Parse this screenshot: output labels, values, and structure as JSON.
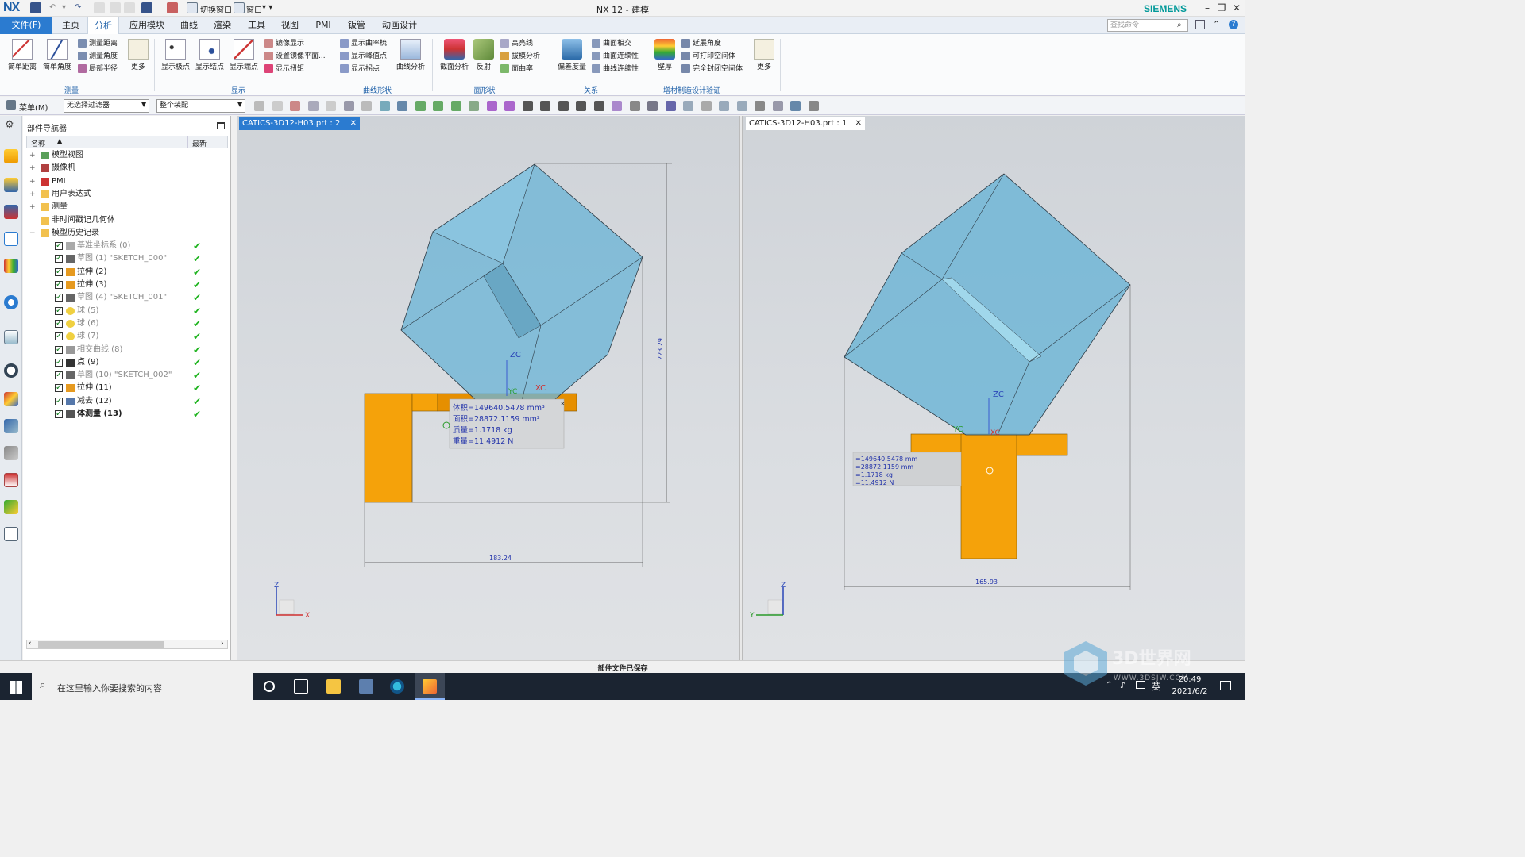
{
  "title_bar": {
    "logo": "NX",
    "window_title": "NX 12 - 建模",
    "brand": "SIEMENS",
    "switch_window_label": "切换窗口",
    "window_menu_label": "窗口"
  },
  "menu": {
    "file": "文件(F)",
    "items": [
      "主页",
      "分析",
      "应用模块",
      "曲线",
      "渲染",
      "工具",
      "视图",
      "PMI",
      "钣管",
      "动画设计"
    ],
    "active": "分析",
    "search_placeholder": "查找命令"
  },
  "ribbon": {
    "measure": {
      "label": "测量",
      "big": [
        "简单距离",
        "简单角度"
      ],
      "small": [
        "测量距离",
        "测量角度",
        "局部半径"
      ],
      "more": "更多"
    },
    "display": {
      "label": "显示",
      "big": [
        "显示极点",
        "显示结点",
        "显示端点"
      ],
      "small": [
        "镜像显示",
        "设置镜像平面...",
        "显示扭矩"
      ]
    },
    "curve_shape": {
      "label": "曲线形状",
      "small": [
        "显示曲率梳",
        "显示峰值点",
        "显示拐点"
      ],
      "big": [
        "曲线分析"
      ]
    },
    "face_shape": {
      "label": "面形状",
      "big": [
        "截面分析",
        "反射"
      ],
      "small": [
        "高亮线",
        "拔模分析",
        "面曲率"
      ]
    },
    "relation": {
      "label": "关系",
      "big": [
        "偏差度量"
      ],
      "small": [
        "曲面相交",
        "曲面连续性",
        "曲线连续性"
      ]
    },
    "am": {
      "label": "增材制造设计验证",
      "big": [
        "壁厚"
      ],
      "small": [
        "延展角度",
        "可打印空间体",
        "完全封闭空间体"
      ],
      "more": "更多"
    }
  },
  "toolbar": {
    "menu_label": "菜单(M)",
    "filter": "无选择过滤器",
    "scope": "整个装配"
  },
  "navigator": {
    "title": "部件导航器",
    "col_name": "名称",
    "col_latest": "最新",
    "rows": [
      {
        "indent": 0,
        "expand": "+",
        "label": "模型视图",
        "grey": false,
        "checked": false,
        "latest": false,
        "icon": "views-icon"
      },
      {
        "indent": 0,
        "expand": "+",
        "label": "摄像机",
        "grey": false,
        "checked": false,
        "latest": false,
        "icon": "camera-icon"
      },
      {
        "indent": 0,
        "expand": "+",
        "label": "PMI",
        "grey": false,
        "checked": false,
        "latest": false,
        "icon": "pmi-icon"
      },
      {
        "indent": 0,
        "expand": "+",
        "label": "用户表达式",
        "grey": false,
        "checked": false,
        "latest": false,
        "icon": "folder-icon"
      },
      {
        "indent": 0,
        "expand": "+",
        "label": "测量",
        "grey": false,
        "checked": false,
        "latest": false,
        "icon": "folder-icon"
      },
      {
        "indent": 0,
        "expand": "",
        "label": "非时间戳记几何体",
        "grey": false,
        "checked": false,
        "latest": false,
        "icon": "folder-icon"
      },
      {
        "indent": 0,
        "expand": "−",
        "label": "模型历史记录",
        "grey": false,
        "checked": false,
        "latest": false,
        "icon": "folder-icon"
      },
      {
        "indent": 1,
        "expand": "",
        "label": "基准坐标系 (0)",
        "grey": true,
        "checked": true,
        "latest": true,
        "icon": "csys-icon"
      },
      {
        "indent": 1,
        "expand": "",
        "label": "草图 (1) \"SKETCH_000\"",
        "grey": true,
        "checked": true,
        "latest": true,
        "icon": "sketch-icon"
      },
      {
        "indent": 1,
        "expand": "",
        "label": "拉伸 (2)",
        "grey": false,
        "checked": true,
        "latest": true,
        "icon": "extrude-icon"
      },
      {
        "indent": 1,
        "expand": "",
        "label": "拉伸 (3)",
        "grey": false,
        "checked": true,
        "latest": true,
        "icon": "extrude-icon"
      },
      {
        "indent": 1,
        "expand": "",
        "label": "草图 (4) \"SKETCH_001\"",
        "grey": true,
        "checked": true,
        "latest": true,
        "icon": "sketch-icon"
      },
      {
        "indent": 1,
        "expand": "",
        "label": "球 (5)",
        "grey": true,
        "checked": true,
        "latest": true,
        "icon": "sphere-icon"
      },
      {
        "indent": 1,
        "expand": "",
        "label": "球 (6)",
        "grey": true,
        "checked": true,
        "latest": true,
        "icon": "sphere-icon"
      },
      {
        "indent": 1,
        "expand": "",
        "label": "球 (7)",
        "grey": true,
        "checked": true,
        "latest": true,
        "icon": "sphere-icon"
      },
      {
        "indent": 1,
        "expand": "",
        "label": "相交曲线 (8)",
        "grey": true,
        "checked": true,
        "latest": true,
        "icon": "curve-icon"
      },
      {
        "indent": 1,
        "expand": "",
        "label": "点 (9)",
        "grey": false,
        "checked": true,
        "latest": true,
        "icon": "point-icon"
      },
      {
        "indent": 1,
        "expand": "",
        "label": "草图 (10) \"SKETCH_002\"",
        "grey": true,
        "checked": true,
        "latest": true,
        "icon": "sketch-icon"
      },
      {
        "indent": 1,
        "expand": "",
        "label": "拉伸 (11)",
        "grey": false,
        "checked": true,
        "latest": true,
        "icon": "extrude-icon"
      },
      {
        "indent": 1,
        "expand": "",
        "label": "减去 (12)",
        "grey": false,
        "checked": true,
        "latest": true,
        "icon": "subtract-icon"
      },
      {
        "indent": 1,
        "expand": "",
        "label": "体测量 (13)",
        "grey": false,
        "checked": true,
        "latest": true,
        "icon": "measure-icon",
        "bold": true
      }
    ]
  },
  "viewport_left": {
    "tab": "CATICS-3D12-H03.prt : 2",
    "dim_height": "223.29",
    "dim_width": "183.24",
    "axes": {
      "z": "ZC",
      "y": "YC",
      "x": "XC"
    },
    "triad": {
      "z": "Z",
      "x": "X"
    },
    "results": [
      "体积=149640.5478 mm³",
      "面积=28872.1159 mm²",
      "质量=1.1718 kg",
      "重量=11.4912 N"
    ]
  },
  "viewport_right": {
    "tab": "CATICS-3D12-H03.prt : 1",
    "dim_width": "165.93",
    "axes": {
      "z": "ZC",
      "y": "YC",
      "x": "XC"
    },
    "triad": {
      "z": "Z",
      "y": "Y"
    },
    "results": [
      "=149640.5478 mm",
      "=28872.1159 mm",
      "=1.1718 kg",
      "=11.4912 N"
    ]
  },
  "status": {
    "message": "部件文件已保存"
  },
  "taskbar": {
    "search_placeholder": "在这里输入你要搜索的内容",
    "time": "20:49",
    "date": "2021/6/2",
    "ime": "英"
  },
  "watermark": {
    "text": "3D世界网",
    "url": "WWW.3DSJW.COM"
  },
  "colors": {
    "accent": "#2b7bd0",
    "cube": "#6db5d6",
    "base": "#f5a20a",
    "check": "#1db31d"
  }
}
